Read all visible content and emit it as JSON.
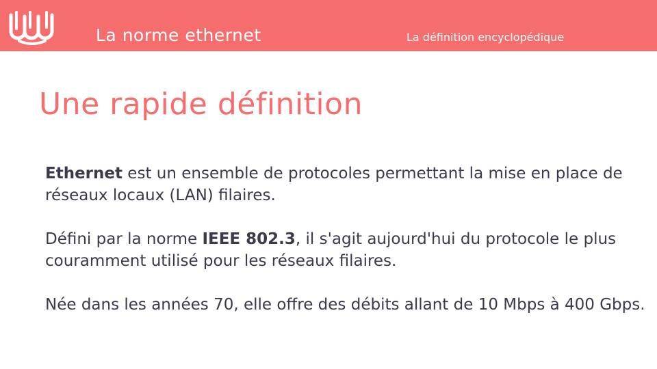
{
  "header": {
    "deck_title": "La norme ethernet",
    "subtitle": "La définition encyclopédique",
    "logo_icon": "wave-logo-icon"
  },
  "slide": {
    "title": "Une rapide définition",
    "paragraphs": [
      {
        "bold": "Ethernet",
        "rest": " est un ensemble de protocoles permettant la mise en place de réseaux locaux (LAN) filaires."
      },
      {
        "before": "Défini par la norme ",
        "bold": "IEEE 802.3",
        "after": ", il s'agit aujourd'hui du protocole le plus couramment utilisé pour les réseaux filaires."
      },
      {
        "text": "Née dans les années 70, elle offre des débits allant de 10 Mbps à 400 Gbps."
      }
    ]
  },
  "colors": {
    "accent": "#f56d6d",
    "text": "#3a3a4a",
    "background": "#ffffff"
  }
}
